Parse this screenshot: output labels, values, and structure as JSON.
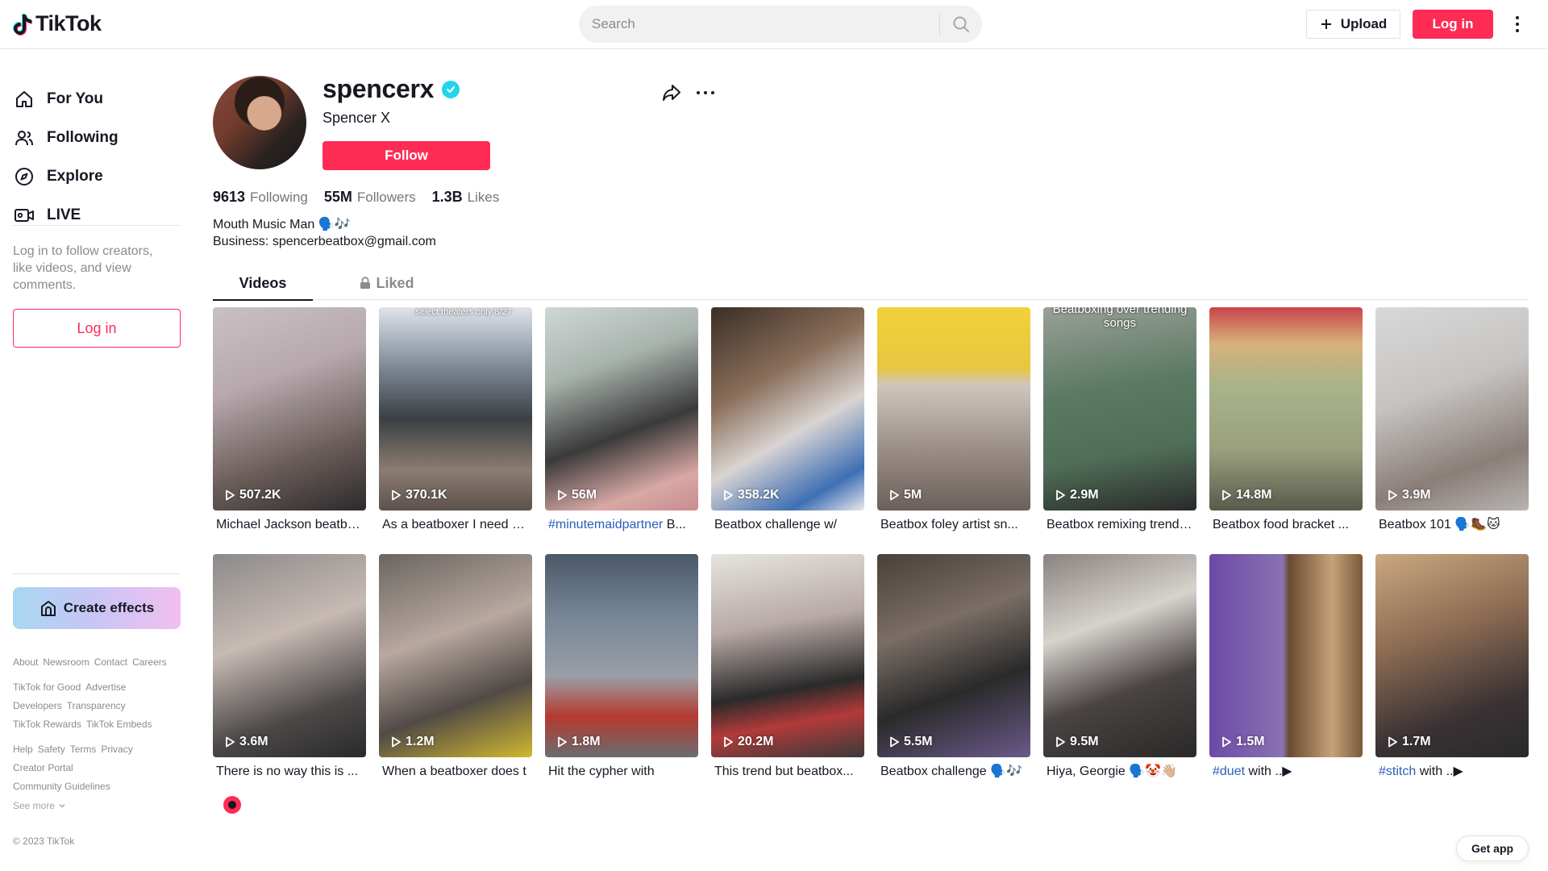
{
  "header": {
    "logo_text": "TikTok",
    "search_placeholder": "Search",
    "upload_label": "Upload",
    "login_label": "Log in"
  },
  "sidebar": {
    "nav": [
      {
        "label": "For You",
        "icon": "home-icon"
      },
      {
        "label": "Following",
        "icon": "people-icon"
      },
      {
        "label": "Explore",
        "icon": "compass-icon"
      },
      {
        "label": "LIVE",
        "icon": "live-camera-icon"
      }
    ],
    "login_tip": "Log in to follow creators, like videos, and view comments.",
    "login_label": "Log in",
    "effects_label": "Create effects",
    "footer_links_1": [
      "About",
      "Newsroom",
      "Contact",
      "Careers"
    ],
    "footer_links_2": [
      "TikTok for Good",
      "Advertise"
    ],
    "footer_links_3": [
      "Developers",
      "Transparency"
    ],
    "footer_links_4": [
      "TikTok Rewards",
      "TikTok Embeds"
    ],
    "footer_links_5": [
      "Help",
      "Safety",
      "Terms",
      "Privacy"
    ],
    "footer_links_6": [
      "Creator Portal"
    ],
    "footer_links_7": [
      "Community Guidelines"
    ],
    "see_more": "See more",
    "copyright": "© 2023 TikTok"
  },
  "profile": {
    "username": "spencerx",
    "display_name": "Spencer X",
    "follow_label": "Follow",
    "following_count": "9613",
    "following_label": "Following",
    "followers_count": "55M",
    "followers_label": "Followers",
    "likes_count": "1.3B",
    "likes_label": "Likes",
    "bio_line1": "Mouth Music Man 🗣️🎶",
    "bio_line2": "Business: spencerbeatbox@gmail.com"
  },
  "tabs": {
    "videos": "Videos",
    "liked": "Liked"
  },
  "videos": [
    {
      "views": "507.2K",
      "caption": "Michael Jackson beatbox...",
      "tag": ""
    },
    {
      "views": "370.1K",
      "caption": "As a beatboxer I need my",
      "tag": "",
      "overlay": "select theaters only 8/27"
    },
    {
      "views": "56M",
      "caption": " B...",
      "tag": "#minutemaidpartner"
    },
    {
      "views": "358.2K",
      "caption": "Beatbox challenge w/",
      "tag": ""
    },
    {
      "views": "5M",
      "caption": "Beatbox foley artist sn...",
      "tag": ""
    },
    {
      "views": "2.9M",
      "caption": "Beatbox remixing trending",
      "tag": "",
      "overlay": "Beatboxing over trending songs"
    },
    {
      "views": "14.8M",
      "caption": "Beatbox food bracket ...",
      "tag": ""
    },
    {
      "views": "3.9M",
      "caption": "Beatbox 101 🗣️🥾🐱",
      "tag": ""
    },
    {
      "views": "3.6M",
      "caption": "There is no way this is ...",
      "tag": ""
    },
    {
      "views": "1.2M",
      "caption": "When a beatboxer does t",
      "tag": ""
    },
    {
      "views": "1.8M",
      "caption": "Hit the cypher with",
      "tag": ""
    },
    {
      "views": "20.2M",
      "caption": "This trend but beatbox...",
      "tag": ""
    },
    {
      "views": "5.5M",
      "caption": "Beatbox challenge 🗣️🎶",
      "tag": ""
    },
    {
      "views": "9.5M",
      "caption": "Hiya, Georgie 🗣️🤡👋🏼",
      "tag": ""
    },
    {
      "views": "1.5M",
      "caption": " with ..▶",
      "tag": "#duet"
    },
    {
      "views": "1.7M",
      "caption": " with ..▶",
      "tag": "#stitch"
    }
  ],
  "get_app": "Get app",
  "colors": {
    "accent": "#fe2c55",
    "verified": "#20d5ec",
    "hashtag": "#2b5db9"
  }
}
